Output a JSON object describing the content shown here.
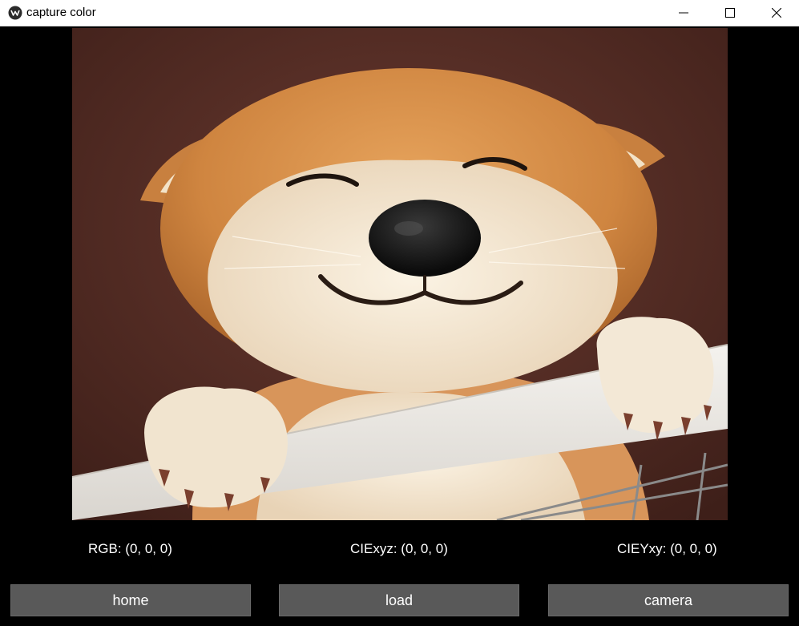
{
  "window": {
    "title": "capture color",
    "accent": "#000000"
  },
  "image": {
    "icon": "shiba-dog-photo"
  },
  "readouts": {
    "rgb": "RGB: (0, 0, 0)",
    "ciexyz": "CIExyz: (0, 0, 0)",
    "cieyxy": "CIEYxy: (0, 0, 0)"
  },
  "buttons": {
    "home": "home",
    "load": "load",
    "camera": "camera"
  },
  "colors": {
    "button_bg": "#595959",
    "background": "#000000",
    "text": "#ffffff"
  }
}
